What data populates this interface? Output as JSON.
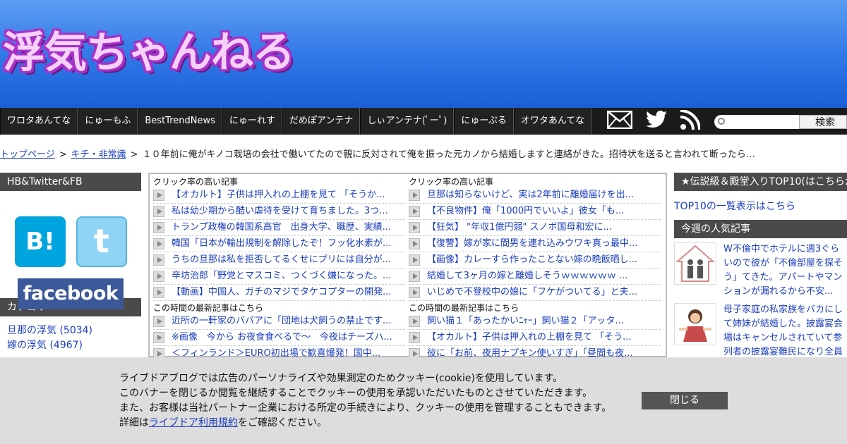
{
  "header": {
    "logo_text": "浮気ちゃんねる"
  },
  "nav": {
    "items": [
      "ワロタあんてな",
      "にゅーもふ",
      "BestTrendNews",
      "にゅーれす",
      "だめぽアンテナ",
      "しぃアンテナ(ﾟーﾟ)",
      "にゅーぷる",
      "オワタあんてな"
    ],
    "icons": [
      "mail-icon",
      "twitter-icon",
      "rss-icon"
    ],
    "search_button": "検索"
  },
  "breadcrumb": {
    "home": "トップページ",
    "category": "キチ・非常識",
    "current": "１０年前に俺がキノコ栽培の会社で働いてたので親に反対されて俺を振った元カノから結婚しますと連絡がきた。招待状を送ると言われて断ったら…"
  },
  "sidebar_left": {
    "social_heading": "HB&Twitter&FB",
    "hb_label": "B!",
    "twitter_label": "t",
    "facebook_label": "facebook",
    "category_heading": "カテゴリー",
    "categories": [
      "旦那の浮気 (5034)",
      "嫁の浮気 (4967)"
    ]
  },
  "main": {
    "left": {
      "click_title": "クリック率の高い記事",
      "click_items": [
        "【オカルト】子供は押入れの上棚を見て 「そうか...",
        "私は幼少期から酷い虐待を受けて育ちました。3つ...",
        "トランプ政権の韓国系高官　出身大学、職歴、実績...",
        "韓国「日本が輸出規制を解除したぞ！フッ化水素が...",
        "うちの旦那は私を拒否してるくせにプリには自分が...",
        "辛坊治郎「野党とマスコミ、つくづく嫌になった。...",
        "【動画】中国人、ガチのマジでタケコプターの開発..."
      ],
      "latest_title": "この時間の最新記事はこちら",
      "latest_items": [
        "近所の一軒家のババアに「団地は犬飼うの禁止です...",
        "※画像　今から お夜食食べるで～　今夜はチーズハ...",
        "＜フィンランド＞EURO初出場で歓喜爆発！国中..."
      ]
    },
    "right": {
      "click_title": "クリック率の高い記事",
      "click_items": [
        "旦那は知らないけど、実は2年前に離婚届けを出...",
        "【不良物件】俺「1000円でいいよ」彼女「も...",
        "【狂気】 \"年収1億円弱\" スノボ国母和宏に...",
        "【復讐】嫁が家に間男を連れ込みウワキ真っ最中...",
        "【画像】カレーすら作ったことない嫁の晩飯晒し...",
        "結婚して3ヶ月の嫁と離婚しそうｗｗｗｗｗｗ ...",
        "いじめで不登校中の娘に「フケがついてる」と夫..."
      ],
      "latest_title": "この時間の最新記事はこちら",
      "latest_items": [
        "飼い猫１「あったかいﾆｬｰ」飼い猫２「アッタ...",
        "【オカルト】子供は押入れの上棚を見て 「そう...",
        "彼に「お前、夜用ナプキン使いすぎ」「昼間も夜..."
      ]
    }
  },
  "sidebar_right": {
    "legend_heading": "★伝説級＆殿堂入りTOP10(はこちらか",
    "top10_link": "TOP10の一覧表示はこちら",
    "weekly_heading": "今週の人気記事",
    "popular": [
      "W不倫中でホテルに週3ぐらいので彼が「不倫部屋を探そう」てきた。アパートやマンションが漏れるから不安...",
      "母子家庭の私家族をバカにして姉妹が結婚した。披露宴会場はキャンセルされていて参列者の披露宴難民になり全員激おこ..."
    ]
  },
  "cookie": {
    "line1": "ライブドアブログでは広告のパーソナライズや効果測定のためクッキー(cookie)を使用しています。",
    "line2": "このバナーを閉じるか閲覧を継続することでクッキーの使用を承認いただいたものとさせていただきます。",
    "line3": "また、お客様は当社パートナー企業における所定の手続きにより、クッキーの使用を管理することもできます。",
    "line4_prefix": "詳細は",
    "line4_link": "ライブドア利用規約",
    "line4_suffix": "をご確認ください。",
    "close_label": "閉じる"
  }
}
